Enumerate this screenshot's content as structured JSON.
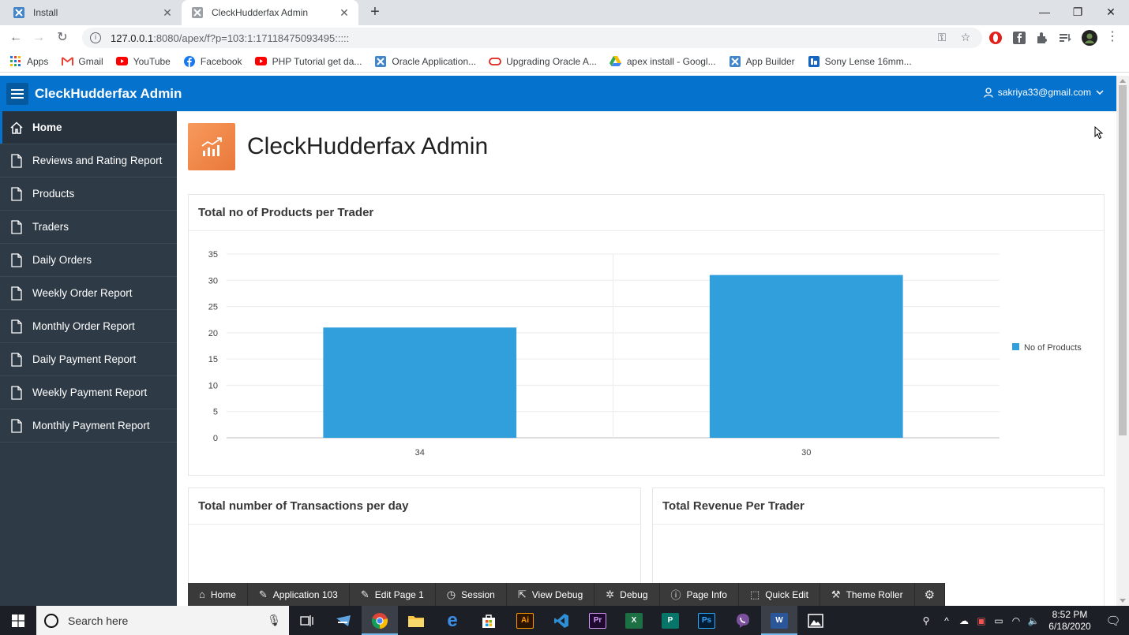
{
  "browser": {
    "tabs": [
      {
        "title": "Install"
      },
      {
        "title": "CleckHudderfax Admin"
      }
    ],
    "url_host": "127.0.0.1",
    "url_path": ":8080/apex/f?p=103:1:17118475093495:::::",
    "bookmarks": [
      {
        "label": "Apps",
        "icon": "apps-grid-icon"
      },
      {
        "label": "Gmail",
        "icon": "gmail-icon"
      },
      {
        "label": "YouTube",
        "icon": "youtube-icon"
      },
      {
        "label": "Facebook",
        "icon": "facebook-icon"
      },
      {
        "label": "PHP Tutorial get da...",
        "icon": "youtube-icon"
      },
      {
        "label": "Oracle Application...",
        "icon": "apex-icon"
      },
      {
        "label": "Upgrading Oracle A...",
        "icon": "oracle-icon"
      },
      {
        "label": "apex install - Googl...",
        "icon": "drive-icon"
      },
      {
        "label": "App Builder",
        "icon": "apex-icon"
      },
      {
        "label": "Sony Lense 16mm...",
        "icon": "bookmark-icon"
      }
    ]
  },
  "header": {
    "app_title": "CleckHudderfax Admin",
    "user": "sakriya33@gmail.com"
  },
  "sidebar": {
    "items": [
      {
        "label": "Home",
        "icon": "home-icon",
        "active": true
      },
      {
        "label": "Reviews and Rating Report",
        "icon": "page-icon"
      },
      {
        "label": "Products",
        "icon": "page-icon"
      },
      {
        "label": "Traders",
        "icon": "page-icon"
      },
      {
        "label": "Daily Orders",
        "icon": "page-icon"
      },
      {
        "label": "Weekly Order Report",
        "icon": "page-icon"
      },
      {
        "label": "Monthly Order Report",
        "icon": "page-icon"
      },
      {
        "label": "Daily Payment Report",
        "icon": "page-icon"
      },
      {
        "label": "Weekly Payment Report",
        "icon": "page-icon"
      },
      {
        "label": "Monthly Payment Report",
        "icon": "page-icon"
      }
    ]
  },
  "main": {
    "page_title": "CleckHudderfax Admin",
    "regions": {
      "products_chart_title": "Total no of Products per Trader",
      "transactions_title": "Total number of Transactions per day",
      "revenue_title": "Total Revenue Per Trader"
    }
  },
  "chart_data": {
    "type": "bar",
    "title": "Total no of Products per Trader",
    "categories": [
      "34",
      "30"
    ],
    "series": [
      {
        "name": "No of Products",
        "values": [
          21,
          31
        ]
      }
    ],
    "ylim": [
      0,
      35
    ],
    "yticks": [
      0,
      5,
      10,
      15,
      20,
      25,
      30,
      35
    ],
    "grid": true,
    "legend": "right",
    "color": "#309fdb"
  },
  "dev_toolbar": {
    "items": [
      {
        "label": "Home",
        "icon": "home-icon"
      },
      {
        "label": "Application 103",
        "icon": "edit-icon"
      },
      {
        "label": "Edit Page 1",
        "icon": "edit-icon"
      },
      {
        "label": "Session",
        "icon": "clock-icon"
      },
      {
        "label": "View Debug",
        "icon": "view-debug-icon"
      },
      {
        "label": "Debug",
        "icon": "bug-icon"
      },
      {
        "label": "Page Info",
        "icon": "info-icon"
      },
      {
        "label": "Quick Edit",
        "icon": "quick-edit-icon"
      },
      {
        "label": "Theme Roller",
        "icon": "paint-roller-icon"
      }
    ]
  },
  "taskbar": {
    "search_placeholder": "Search here",
    "time": "8:52 PM",
    "date": "6/18/2020"
  }
}
